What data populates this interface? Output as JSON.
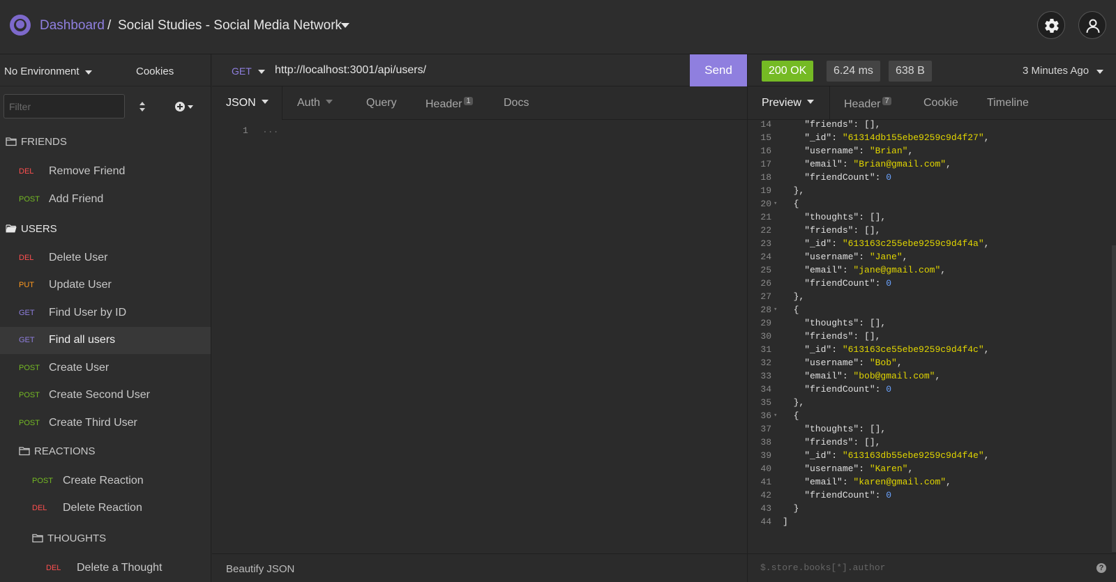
{
  "header": {
    "dashboard": "Dashboard",
    "separator": "/",
    "workspace": "Social Studies - Social Media Network"
  },
  "sidebar": {
    "environment": "No Environment",
    "cookies": "Cookies",
    "filter_placeholder": "Filter",
    "folders": {
      "friends": "FRIENDS",
      "users": "USERS",
      "reactions": "REACTIONS",
      "thoughts": "THOUGHTS"
    },
    "requests": [
      {
        "method": "DEL",
        "name": "Remove Friend"
      },
      {
        "method": "POST",
        "name": "Add Friend"
      },
      {
        "method": "DEL",
        "name": "Delete User"
      },
      {
        "method": "PUT",
        "name": "Update User"
      },
      {
        "method": "GET",
        "name": "Find User by ID"
      },
      {
        "method": "GET",
        "name": "Find all users"
      },
      {
        "method": "POST",
        "name": "Create User"
      },
      {
        "method": "POST",
        "name": "Create Second User"
      },
      {
        "method": "POST",
        "name": "Create Third User"
      },
      {
        "method": "POST",
        "name": "Create Reaction"
      },
      {
        "method": "DEL",
        "name": "Delete Reaction"
      },
      {
        "method": "DEL",
        "name": "Delete a Thought"
      }
    ]
  },
  "request": {
    "method": "GET",
    "url": "http://localhost:3001/api/users/",
    "send": "Send",
    "tabs": {
      "body": "JSON",
      "auth": "Auth",
      "query": "Query",
      "header": "Header",
      "header_count": "1",
      "docs": "Docs"
    },
    "line_number": "1",
    "placeholder": "...",
    "beautify": "Beautify JSON"
  },
  "response": {
    "status": "200 OK",
    "time": "6.24 ms",
    "size": "638 B",
    "ago": "3 Minutes Ago",
    "tabs": {
      "preview": "Preview",
      "header": "Header",
      "header_count": "7",
      "cookie": "Cookie",
      "timeline": "Timeline"
    },
    "jsonpath_placeholder": "$.store.books[*].author",
    "help": "?",
    "lines": [
      {
        "n": "14",
        "t": "    \"friends\": [],"
      },
      {
        "n": "15",
        "t": "    \"_id\": \"61314db155ebe9259c9d4f27\","
      },
      {
        "n": "16",
        "t": "    \"username\": \"Brian\","
      },
      {
        "n": "17",
        "t": "    \"email\": \"Brian@gmail.com\","
      },
      {
        "n": "18",
        "t": "    \"friendCount\": 0"
      },
      {
        "n": "19",
        "t": "  },"
      },
      {
        "n": "20",
        "t": "  {",
        "fold": true
      },
      {
        "n": "21",
        "t": "    \"thoughts\": [],"
      },
      {
        "n": "22",
        "t": "    \"friends\": [],"
      },
      {
        "n": "23",
        "t": "    \"_id\": \"613163c255ebe9259c9d4f4a\","
      },
      {
        "n": "24",
        "t": "    \"username\": \"Jane\","
      },
      {
        "n": "25",
        "t": "    \"email\": \"jane@gmail.com\","
      },
      {
        "n": "26",
        "t": "    \"friendCount\": 0"
      },
      {
        "n": "27",
        "t": "  },"
      },
      {
        "n": "28",
        "t": "  {",
        "fold": true
      },
      {
        "n": "29",
        "t": "    \"thoughts\": [],"
      },
      {
        "n": "30",
        "t": "    \"friends\": [],"
      },
      {
        "n": "31",
        "t": "    \"_id\": \"613163ce55ebe9259c9d4f4c\","
      },
      {
        "n": "32",
        "t": "    \"username\": \"Bob\","
      },
      {
        "n": "33",
        "t": "    \"email\": \"bob@gmail.com\","
      },
      {
        "n": "34",
        "t": "    \"friendCount\": 0"
      },
      {
        "n": "35",
        "t": "  },"
      },
      {
        "n": "36",
        "t": "  {",
        "fold": true
      },
      {
        "n": "37",
        "t": "    \"thoughts\": [],"
      },
      {
        "n": "38",
        "t": "    \"friends\": [],"
      },
      {
        "n": "39",
        "t": "    \"_id\": \"613163db55ebe9259c9d4f4e\","
      },
      {
        "n": "40",
        "t": "    \"username\": \"Karen\","
      },
      {
        "n": "41",
        "t": "    \"email\": \"karen@gmail.com\","
      },
      {
        "n": "42",
        "t": "    \"friendCount\": 0"
      },
      {
        "n": "43",
        "t": "  }"
      },
      {
        "n": "44",
        "t": "]"
      }
    ]
  },
  "colors": {
    "accent": "#8f7fdf",
    "get": "#8f7fdf",
    "post": "#75ba24",
    "put": "#ff9a1f",
    "del": "#ff4f4f",
    "ok": "#75ba24"
  }
}
